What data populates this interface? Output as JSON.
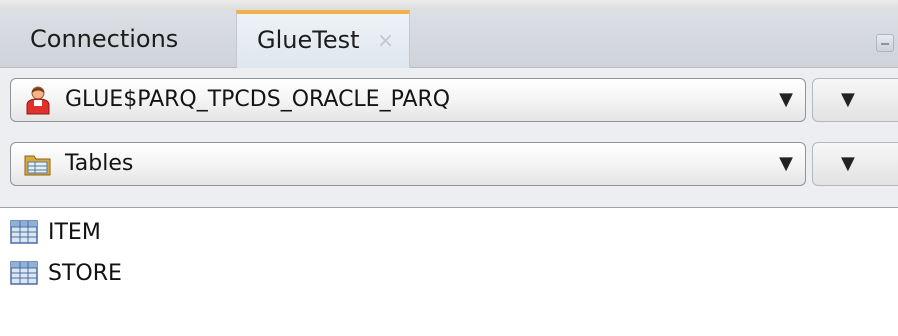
{
  "tabs": [
    {
      "label": "Connections",
      "active": false
    },
    {
      "label": "GlueTest",
      "active": true,
      "close_glyph": "×"
    }
  ],
  "schema_selector": {
    "value": "GLUE$PARQ_TPCDS_ORACLE_PARQ",
    "icon": "user-icon"
  },
  "object_type_selector": {
    "value": "Tables",
    "icon": "folder-icon"
  },
  "dropdown_glyph": "▼",
  "object_list": [
    {
      "label": "ITEM",
      "icon": "table-icon"
    },
    {
      "label": "STORE",
      "icon": "table-icon"
    }
  ],
  "colors": {
    "active_tab_accent": "#f0b04a",
    "tabbar_bg": "#d6dae0",
    "toolbar_bg": "#eceef1"
  }
}
